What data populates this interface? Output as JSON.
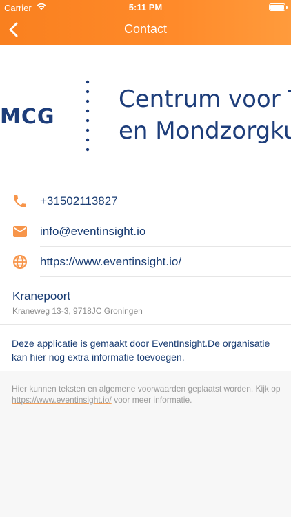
{
  "status_bar": {
    "carrier": "Carrier",
    "time": "5:11 PM"
  },
  "nav": {
    "title": "Contact",
    "back_icon": "chevron-left-icon"
  },
  "logo": {
    "mcg": "MCG",
    "line1": "Centrum voor Tandheelkunde",
    "line2": "en Mondzorgkunde"
  },
  "contact": {
    "phone": "+31502113827",
    "email": "info@eventinsight.io",
    "website": "https://www.eventinsight.io/",
    "location_name": "Kranepoort",
    "location_address": "Kraneweg 13-3, 9718JC Groningen",
    "description": "Deze applicatie is gemaakt door EventInsight.De organisatie kan hier nog extra informatie toevoegen."
  },
  "footer": {
    "text_before": "Hier kunnen teksten en algemene voorwaarden geplaatst worden. Kijk op ",
    "link": "https://www.eventinsight.io/",
    "text_after": " voor meer informatie."
  },
  "colors": {
    "accent": "#f9801f",
    "text_primary": "#1a3d73",
    "text_secondary": "#8c8c8c"
  }
}
